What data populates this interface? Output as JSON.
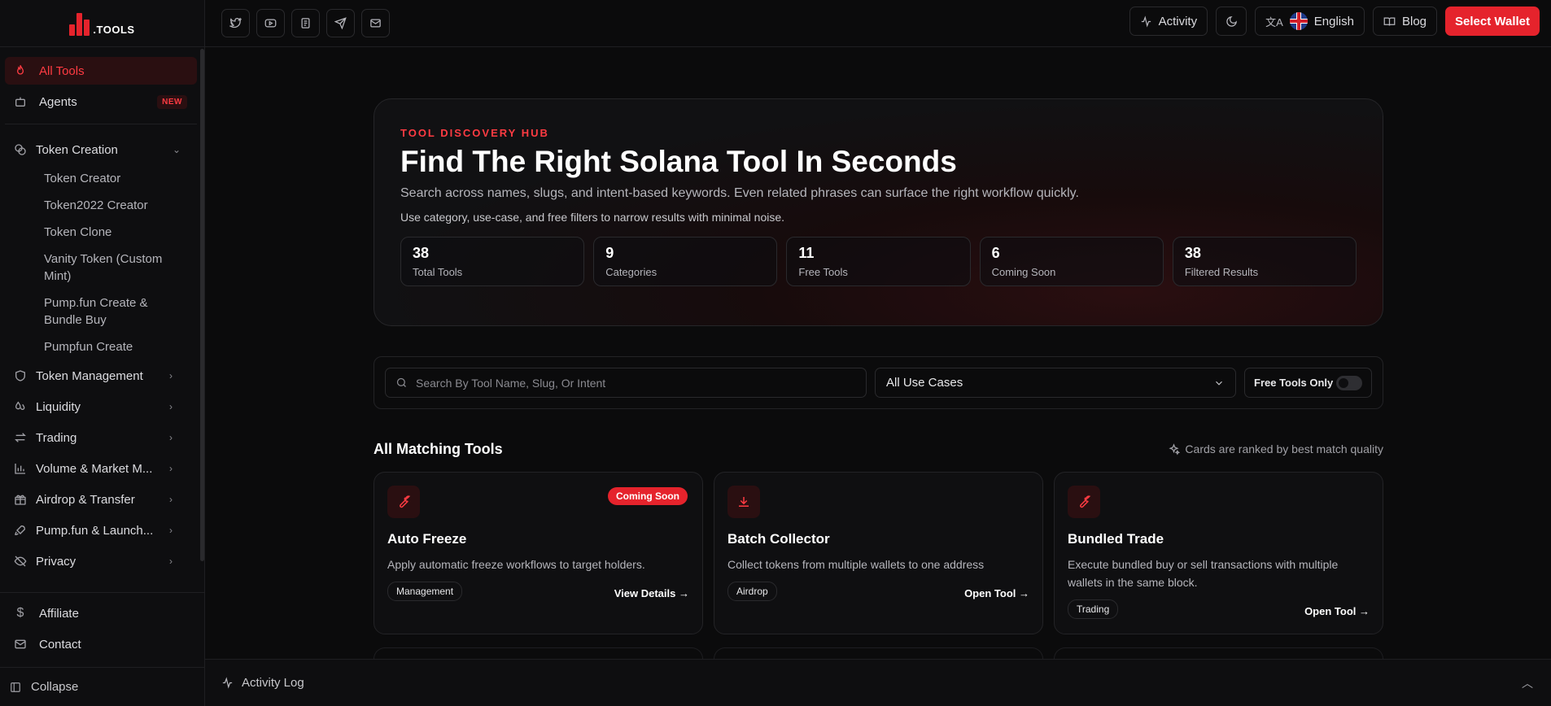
{
  "brand": {
    "logo_text": ".TOOLS",
    "accent": "#e5232c"
  },
  "sidebar": {
    "primary": [
      {
        "label": "All Tools",
        "icon": "flame-icon",
        "active": true
      },
      {
        "label": "Agents",
        "icon": "bot-icon",
        "badge": "NEW"
      }
    ],
    "token_creation": {
      "label": "Token Creation",
      "items": [
        "Token Creator",
        "Token2022 Creator",
        "Token Clone",
        "Vanity Token (Custom Mint)",
        "Pump.fun Create & Bundle Buy",
        "Pumpfun Create"
      ]
    },
    "categories": [
      "Token Management",
      "Liquidity",
      "Trading",
      "Volume & Market M...",
      "Airdrop & Transfer",
      "Pump.fun & Launch...",
      "Privacy"
    ],
    "bottom": [
      "Affiliate",
      "Contact"
    ],
    "collapse": "Collapse"
  },
  "topbar": {
    "social_icons": [
      "twitter-icon",
      "youtube-icon",
      "docs-icon",
      "telegram-icon",
      "mail-icon"
    ],
    "activity": "Activity",
    "language": "English",
    "blog": "Blog",
    "select_wallet": "Select Wallet"
  },
  "hero": {
    "eyebrow": "TOOL DISCOVERY HUB",
    "title": "Find The Right Solana Tool In Seconds",
    "description": "Search across names, slugs, and intent-based keywords. Even related phrases can surface the right workflow quickly.",
    "note": "Use category, use-case, and free filters to narrow results with minimal noise.",
    "stats": [
      {
        "value": "38",
        "label": "Total Tools"
      },
      {
        "value": "9",
        "label": "Categories"
      },
      {
        "value": "11",
        "label": "Free Tools"
      },
      {
        "value": "6",
        "label": "Coming Soon"
      },
      {
        "value": "38",
        "label": "Filtered Results"
      }
    ]
  },
  "filters": {
    "search_placeholder": "Search By Tool Name, Slug, Or Intent",
    "use_case": "All Use Cases",
    "free_only": "Free Tools Only",
    "free_only_enabled": false
  },
  "results": {
    "title": "All Matching Tools",
    "hint": "Cards are ranked by best match quality",
    "cards": [
      {
        "title": "Auto Freeze",
        "desc": "Apply automatic freeze workflows to target holders.",
        "tag": "Management",
        "link": "View Details",
        "badge": "Coming Soon"
      },
      {
        "title": "Batch Collector",
        "desc": "Collect tokens from multiple wallets to one address",
        "tag": "Airdrop",
        "link": "Open Tool"
      },
      {
        "title": "Bundled Trade",
        "desc": "Execute bundled buy or sell transactions with multiple wallets in the same block.",
        "tag": "Trading",
        "link": "Open Tool"
      }
    ]
  },
  "activity_log": {
    "label": "Activity Log"
  }
}
